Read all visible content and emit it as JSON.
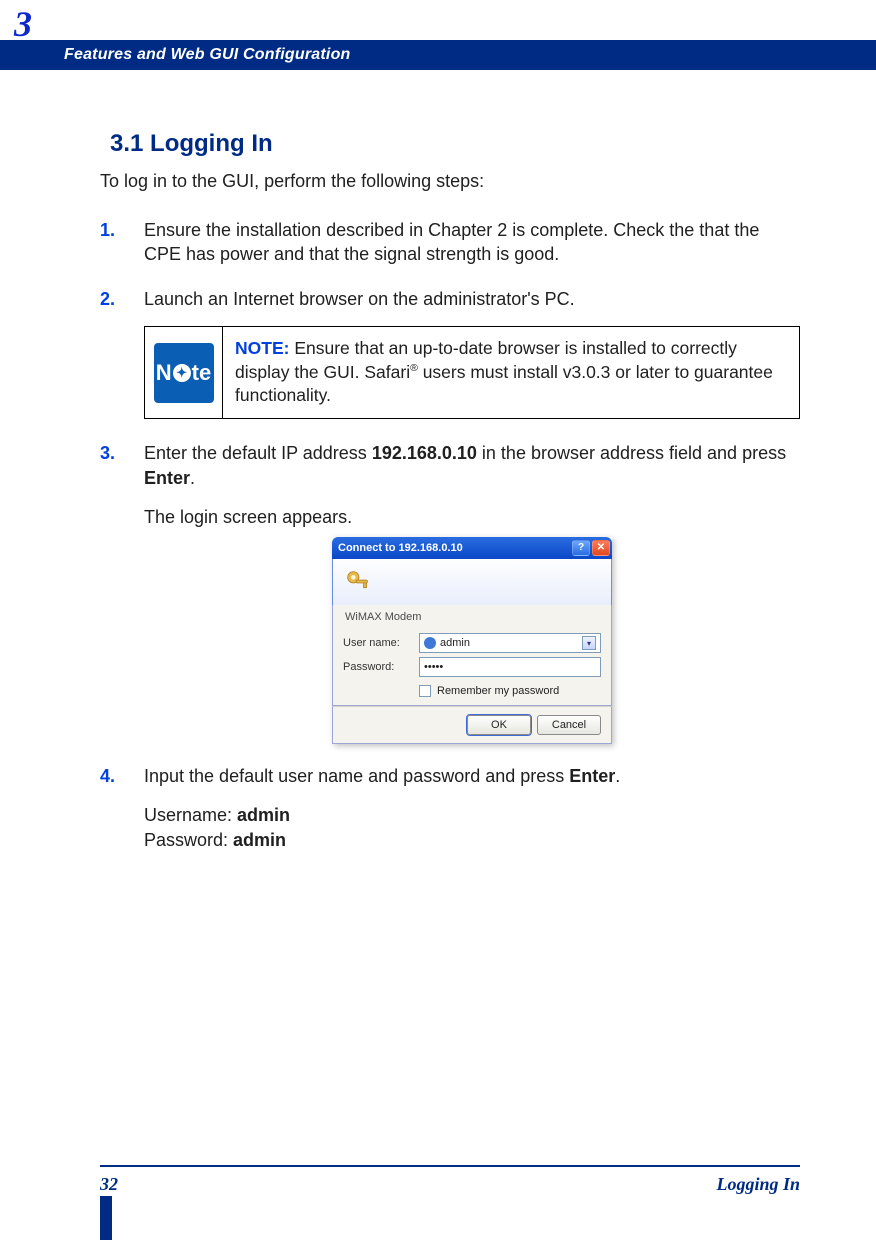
{
  "chapter_number": "3",
  "header_title": "Features and Web GUI Configuration",
  "section_heading": "3.1 Logging In",
  "section_intro": "To log in to the GUI, perform the following steps:",
  "steps": [
    {
      "n": "1.",
      "text": "Ensure the installation described in Chapter 2 is complete. Check the that the CPE has power and that the signal strength is good."
    },
    {
      "n": "2.",
      "text": "Launch an Internet browser on the administrator's PC."
    },
    {
      "n": "3.",
      "pre": "Enter the default IP address ",
      "bold1": "192.168.0.10",
      "mid": " in the browser address field and press ",
      "bold2": "Enter",
      "tail": ".",
      "after": "The login screen appears."
    },
    {
      "n": "4.",
      "pre": "Input the default user name and password and press ",
      "bold1": "Enter",
      "tail": ".",
      "creds": {
        "u_label": "Username: ",
        "u_val": "admin",
        "p_label": "Password: ",
        "p_val": "admin"
      }
    }
  ],
  "note": {
    "badge_left": "N",
    "badge_right": "te",
    "lead": "NOTE:",
    "text_a": " Ensure that an up-to-date browser is installed to correctly display the GUI. Safari",
    "sup": "®",
    "text_b": " users must install v3.0.3 or later to guarantee functionality."
  },
  "dialog": {
    "title": "Connect to 192.168.0.10",
    "realm": "WiMAX Modem",
    "user_label": "User name:",
    "user_value": "admin",
    "pass_label": "Password:",
    "pass_value": "•••••",
    "remember": "Remember my password",
    "ok": "OK",
    "cancel": "Cancel"
  },
  "footer": {
    "page": "32",
    "section": "Logging In"
  }
}
